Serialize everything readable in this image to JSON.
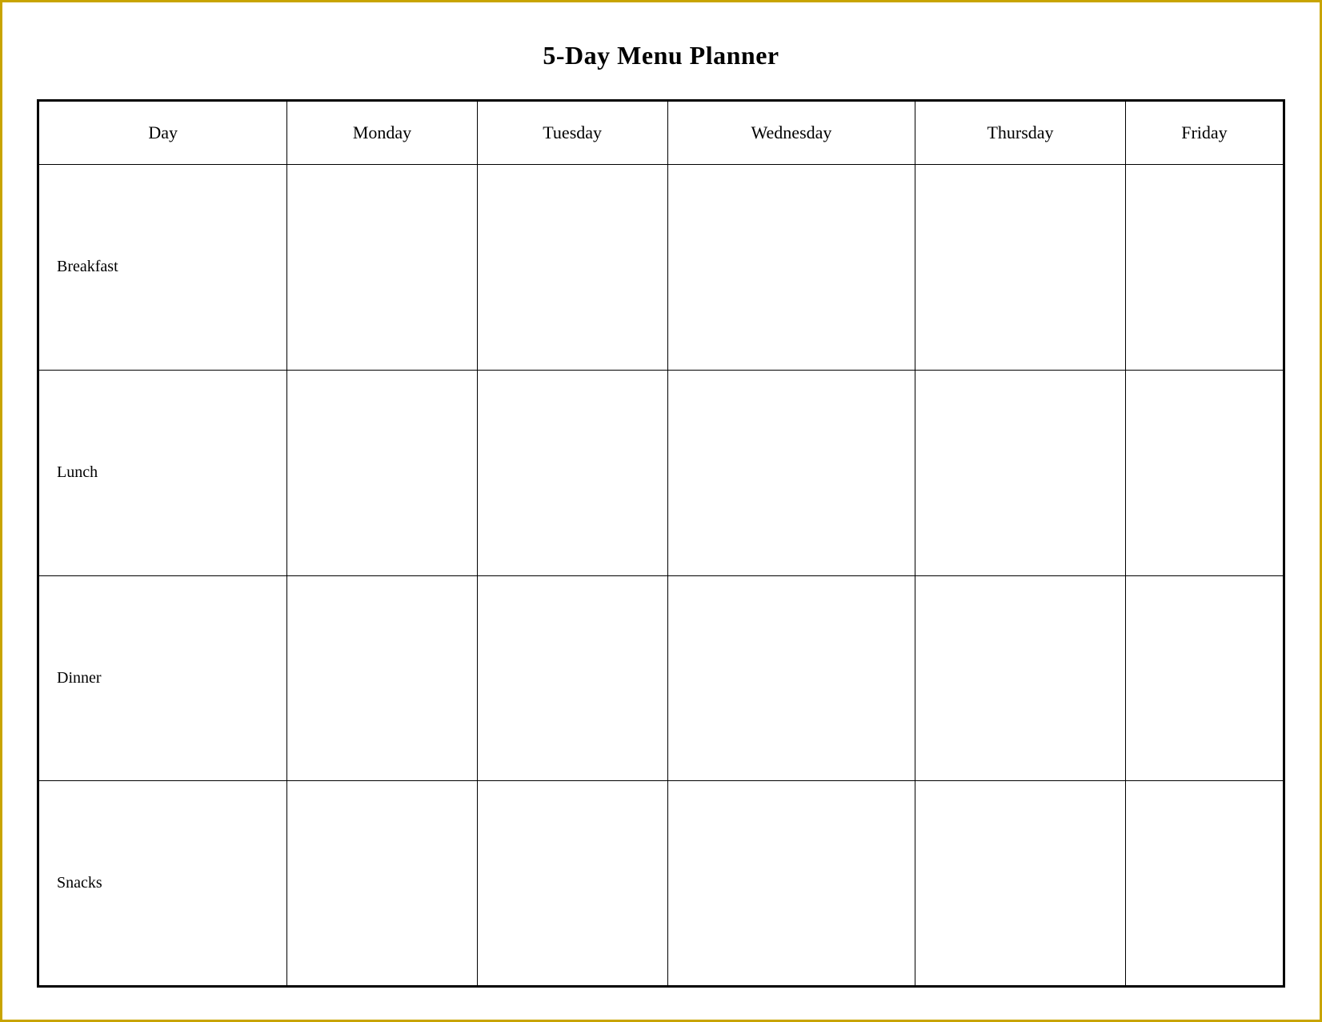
{
  "title": "5-Day Menu Planner",
  "header": {
    "col0": "Day",
    "col1": "Monday",
    "col2": "Tuesday",
    "col3": "Wednesday",
    "col4": "Thursday",
    "col5": "Friday"
  },
  "rows": [
    {
      "label": "Breakfast",
      "cells": [
        "",
        "",
        "",
        "",
        ""
      ]
    },
    {
      "label": "Lunch",
      "cells": [
        "",
        "",
        "",
        "",
        ""
      ]
    },
    {
      "label": "Dinner",
      "cells": [
        "",
        "",
        "",
        "",
        ""
      ]
    },
    {
      "label": "Snacks",
      "cells": [
        "",
        "",
        "",
        "",
        ""
      ]
    }
  ]
}
